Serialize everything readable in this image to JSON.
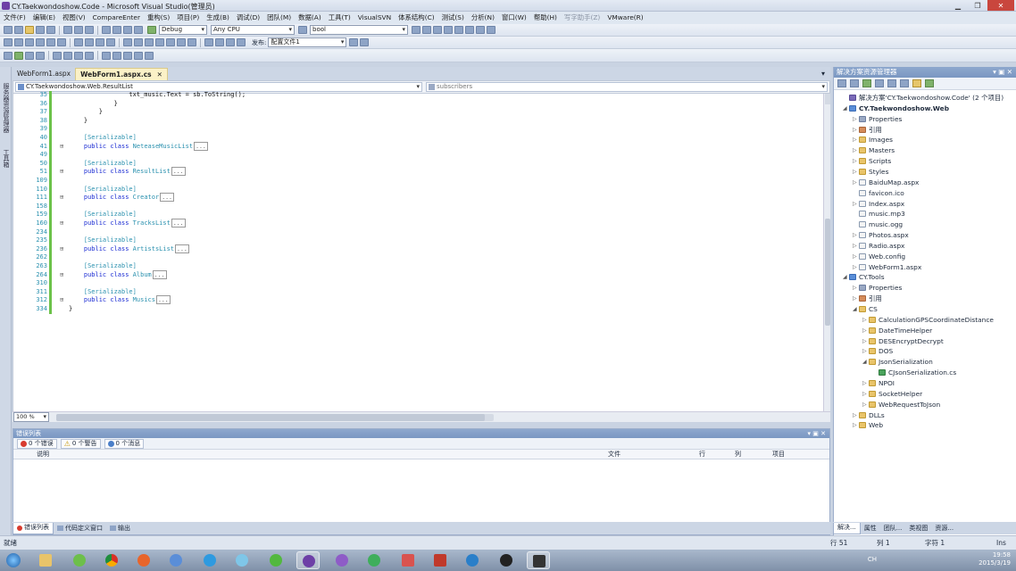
{
  "window": {
    "title": "CY.Taekwondoshow.Code - Microsoft Visual Studio(管理员)"
  },
  "menu": [
    "文件(F)",
    "编辑(E)",
    "视图(V)",
    "CompareEnter",
    "重构(S)",
    "项目(P)",
    "生成(B)",
    "调试(D)",
    "团队(M)",
    "数据(A)",
    "工具(T)",
    "VisualSVN",
    "体系结构(C)",
    "测试(S)",
    "分析(N)",
    "窗口(W)",
    "帮助(H)",
    "写字助手(Z)",
    "VMware(R)"
  ],
  "toolbar": {
    "config_combo": "Debug",
    "platform_combo": "Any CPU",
    "find_combo": "bool",
    "publish_label": "发布:",
    "publish_combo": "配置文件1"
  },
  "left_strip": {
    "items": [
      "服务器资源管理器",
      "工具箱"
    ]
  },
  "tabs": [
    {
      "label": "WebForm1.aspx",
      "active": false
    },
    {
      "label": "WebForm1.aspx.cs",
      "active": true
    }
  ],
  "navbar": {
    "type": "CY.Taekwondoshow.Web.ResultList",
    "member": "subscribers"
  },
  "code_lines": [
    {
      "ln": "35",
      "text": "                txt_music.Text = sb.ToString();"
    },
    {
      "ln": "36",
      "text": "            }"
    },
    {
      "ln": "37",
      "text": "        }"
    },
    {
      "ln": "38",
      "text": "    }"
    },
    {
      "ln": "39",
      "text": ""
    },
    {
      "ln": "40",
      "attr": "[Serializable]"
    },
    {
      "ln": "41",
      "cls": "NeteaseMusicList"
    },
    {
      "ln": "49",
      "text": ""
    },
    {
      "ln": "50",
      "attr": "[Serializable]"
    },
    {
      "ln": "51",
      "cls": "ResultList"
    },
    {
      "ln": "109",
      "text": ""
    },
    {
      "ln": "110",
      "attr": "[Serializable]"
    },
    {
      "ln": "111",
      "cls": "Creator"
    },
    {
      "ln": "158",
      "text": ""
    },
    {
      "ln": "159",
      "attr": "[Serializable]"
    },
    {
      "ln": "160",
      "cls": "TracksList"
    },
    {
      "ln": "234",
      "text": ""
    },
    {
      "ln": "235",
      "attr": "[Serializable]"
    },
    {
      "ln": "236",
      "cls": "ArtistsList"
    },
    {
      "ln": "262",
      "text": ""
    },
    {
      "ln": "263",
      "attr": "[Serializable]"
    },
    {
      "ln": "264",
      "cls": "Album"
    },
    {
      "ln": "310",
      "text": ""
    },
    {
      "ln": "311",
      "attr": "[Serializable]"
    },
    {
      "ln": "312",
      "cls": "Musics"
    },
    {
      "ln": "334",
      "text": "}"
    }
  ],
  "code_keywords": {
    "pub": "public",
    "cls": "class",
    "collapsed": "..."
  },
  "editor": {
    "zoom": "100 %"
  },
  "error_list": {
    "title": "错误列表",
    "errors": "0 个错误",
    "warnings": "0 个警告",
    "messages": "0 个消息",
    "columns": {
      "desc": "说明",
      "file": "文件",
      "line": "行",
      "col": "列",
      "project": "项目"
    }
  },
  "bottom_tabs": [
    "错误列表",
    "代码定义窗口",
    "输出"
  ],
  "solution": {
    "title": "解决方案资源管理器",
    "tree": [
      {
        "label": "解决方案'CY.Taekwondoshow.Code' (2 个项目)",
        "depth": 0,
        "icon": "sol",
        "exp": ""
      },
      {
        "label": "CY.Taekwondoshow.Web",
        "depth": 0,
        "icon": "proj",
        "exp": "◢",
        "bold": true
      },
      {
        "label": "Properties",
        "depth": 1,
        "icon": "prop",
        "exp": "▷"
      },
      {
        "label": "引用",
        "depth": 1,
        "icon": "ref",
        "exp": "▷"
      },
      {
        "label": "Images",
        "depth": 1,
        "icon": "folder",
        "exp": "▷"
      },
      {
        "label": "Masters",
        "depth": 1,
        "icon": "folder",
        "exp": "▷"
      },
      {
        "label": "Scripts",
        "depth": 1,
        "icon": "folder",
        "exp": "▷"
      },
      {
        "label": "Styles",
        "depth": 1,
        "icon": "folder",
        "exp": "▷"
      },
      {
        "label": "BaiduMap.aspx",
        "depth": 1,
        "icon": "file",
        "exp": "▷"
      },
      {
        "label": "favicon.ico",
        "depth": 1,
        "icon": "file",
        "exp": ""
      },
      {
        "label": "Index.aspx",
        "depth": 1,
        "icon": "file",
        "exp": "▷"
      },
      {
        "label": "music.mp3",
        "depth": 1,
        "icon": "file",
        "exp": ""
      },
      {
        "label": "music.ogg",
        "depth": 1,
        "icon": "file",
        "exp": ""
      },
      {
        "label": "Photos.aspx",
        "depth": 1,
        "icon": "file",
        "exp": "▷"
      },
      {
        "label": "Radio.aspx",
        "depth": 1,
        "icon": "file",
        "exp": "▷"
      },
      {
        "label": "Web.config",
        "depth": 1,
        "icon": "file",
        "exp": "▷"
      },
      {
        "label": "WebForm1.aspx",
        "depth": 1,
        "icon": "file",
        "exp": "▷"
      },
      {
        "label": "CY.Tools",
        "depth": 0,
        "icon": "proj",
        "exp": "◢"
      },
      {
        "label": "Properties",
        "depth": 1,
        "icon": "prop",
        "exp": "▷"
      },
      {
        "label": "引用",
        "depth": 1,
        "icon": "ref",
        "exp": "▷"
      },
      {
        "label": "CS",
        "depth": 1,
        "icon": "folder",
        "exp": "◢"
      },
      {
        "label": "CalculationGPSCoordinateDistance",
        "depth": 2,
        "icon": "folder",
        "exp": "▷"
      },
      {
        "label": "DateTimeHelper",
        "depth": 2,
        "icon": "folder",
        "exp": "▷"
      },
      {
        "label": "DESEncryptDecrypt",
        "depth": 2,
        "icon": "folder",
        "exp": "▷"
      },
      {
        "label": "DOS",
        "depth": 2,
        "icon": "folder",
        "exp": "▷"
      },
      {
        "label": "JsonSerialization",
        "depth": 2,
        "icon": "folder",
        "exp": "◢"
      },
      {
        "label": "CJsonSerialization.cs",
        "depth": 3,
        "icon": "cs",
        "exp": ""
      },
      {
        "label": "NPOI",
        "depth": 2,
        "icon": "folder",
        "exp": "▷"
      },
      {
        "label": "SocketHelper",
        "depth": 2,
        "icon": "folder",
        "exp": "▷"
      },
      {
        "label": "WebRequestToJson",
        "depth": 2,
        "icon": "folder",
        "exp": "▷"
      },
      {
        "label": "DLLs",
        "depth": 1,
        "icon": "folder",
        "exp": "▷"
      },
      {
        "label": "Web",
        "depth": 1,
        "icon": "folder",
        "exp": "▷"
      }
    ],
    "tabs": [
      "解决...",
      "属性",
      "团队...",
      "类视图",
      "资源..."
    ]
  },
  "status": {
    "ready": "就绪",
    "line": "行 51",
    "col": "列 1",
    "char": "字符 1",
    "mode": "Ins"
  },
  "tray": {
    "time": "19:58",
    "date": "2015/3/19",
    "lang": "CH"
  },
  "colors": {
    "changed_bar": "#6cc24a",
    "keyword": "#1b2cd3",
    "type": "#2b91af"
  }
}
